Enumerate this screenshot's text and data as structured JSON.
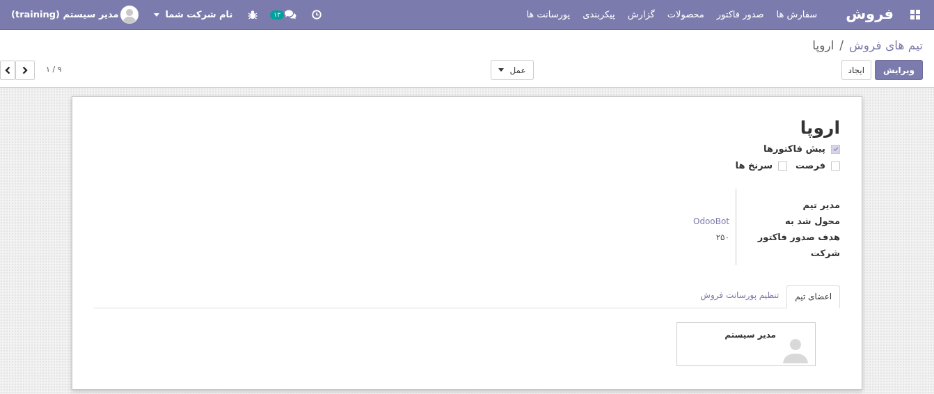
{
  "navbar": {
    "app_name": "فروش",
    "menu": [
      "سفارش ها",
      "صدور فاکتور",
      "محصولات",
      "گزارش",
      "پیکربندی",
      "پورسانت ها"
    ],
    "messages_badge": "۱۳",
    "company": "نام شرکت شما",
    "user": "مدیر سیستم (training)"
  },
  "breadcrumb": [
    "تیم های فروش",
    "اروپا"
  ],
  "breadcrumb_separator": "/",
  "buttons": {
    "edit": "ویرایش",
    "create": "ایجاد",
    "action": "عمل"
  },
  "pager": "۱ / ۹",
  "record": {
    "title": "اروپا",
    "option_rows": [
      [
        {
          "label": "پیش فاکتورها",
          "checked": true,
          "disabled": true
        }
      ],
      [
        {
          "label": "فرصت",
          "checked": false,
          "disabled": false
        },
        {
          "label": "سرنخ ها",
          "checked": false,
          "disabled": false
        }
      ]
    ],
    "fields": [
      {
        "label": "مدیر تیم"
      },
      {
        "label": "محول شد به",
        "value": "OdooBot",
        "kind": "link"
      },
      {
        "label": "هدف صدور فاکتور",
        "value": "۲۵۰",
        "kind": "text"
      },
      {
        "label": "شرکت"
      }
    ]
  },
  "tabs": [
    {
      "label": "اعضای تیم",
      "selected": true
    },
    {
      "label": "تنظیم پورسانت فروش",
      "selected": false
    }
  ],
  "members": [
    {
      "name": "مدیر سیستم"
    }
  ]
}
